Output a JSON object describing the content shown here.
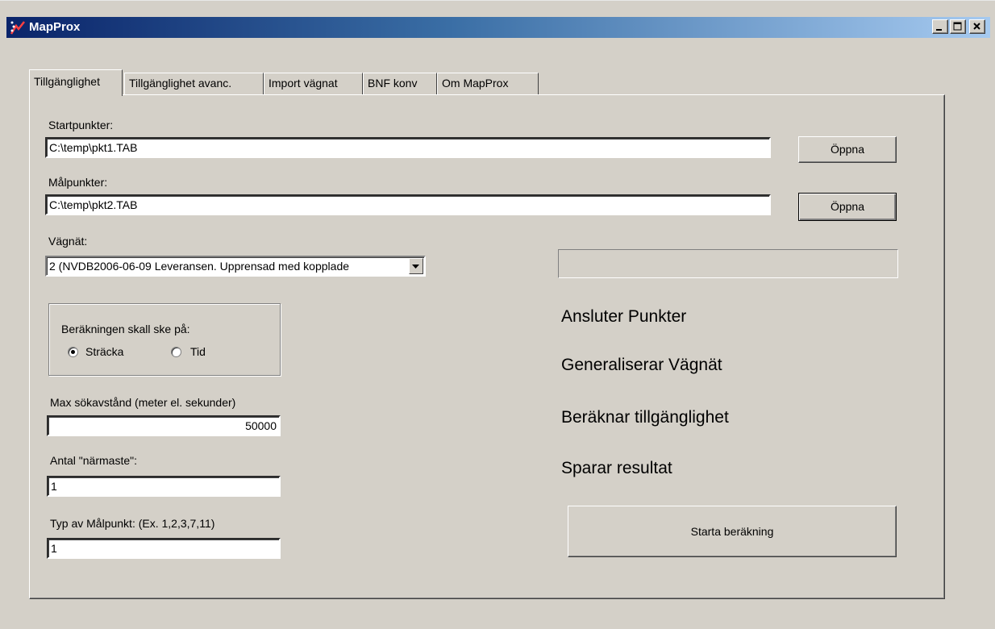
{
  "window": {
    "title": "MapProx"
  },
  "tabs": [
    {
      "label": "Tillgänglighet",
      "active": true
    },
    {
      "label": "Tillgänglighet avanc.",
      "active": false
    },
    {
      "label": "Import vägnat",
      "active": false
    },
    {
      "label": "BNF konv",
      "active": false
    },
    {
      "label": "Om MapProx",
      "active": false
    }
  ],
  "form": {
    "start_label": "Startpunkter:",
    "start_value": "C:\\temp\\pkt1.TAB",
    "open_label": "Öppna",
    "target_label": "Målpunkter:",
    "target_value": "C:\\temp\\pkt2.TAB",
    "network_label": "Vägnät:",
    "network_value": "2 (NVDB2006-06-09 Leveransen. Upprensad med kopplade",
    "calc_group_label": "Beräkningen skall ske på:",
    "option_distance": "Sträcka",
    "option_time": "Tid",
    "selected_option": "Sträcka",
    "max_dist_label": "Max sökavstånd (meter el. sekunder)",
    "max_dist_value": "50000",
    "nearest_label": "Antal \"närmaste\":",
    "nearest_value": "1",
    "target_type_label": "Typ av Målpunkt: (Ex. 1,2,3,7,11)",
    "target_type_value": "1"
  },
  "status": {
    "progress": 0,
    "steps": [
      "Ansluter Punkter",
      "Generaliserar Vägnät",
      "Beräknar tillgänglighet",
      "Sparar resultat"
    ]
  },
  "actions": {
    "start_label": "Starta beräkning"
  },
  "colors": {
    "title_start": "#0a246a",
    "title_end": "#a6caf0",
    "face": "#d4d0c8"
  }
}
